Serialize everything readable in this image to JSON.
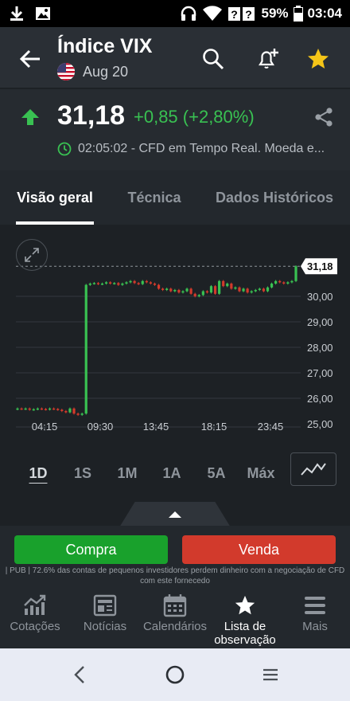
{
  "status_bar": {
    "battery": "59%",
    "time": "03:04"
  },
  "header": {
    "title": "Índice VIX",
    "date": "Aug 20"
  },
  "quote": {
    "price": "31,18",
    "change": "+0,85 (+2,80%)",
    "time_info": "02:05:02 - CFD em Tempo Real. Moeda e...",
    "up_color": "#39c152"
  },
  "tabs": [
    {
      "label": "Visão geral",
      "active": true
    },
    {
      "label": "Técnica",
      "active": false
    },
    {
      "label": "Dados Históricos",
      "active": false
    }
  ],
  "chart_data": {
    "type": "candlestick",
    "y_ticks": [
      "31,18",
      "30,00",
      "29,00",
      "28,00",
      "27,00",
      "26,00",
      "25,00"
    ],
    "x_ticks": [
      "04:15",
      "09:30",
      "13:45",
      "18:15",
      "23:45"
    ],
    "last_value": "31,18",
    "ylim": [
      25.0,
      31.5
    ],
    "closes": [
      25.6,
      25.58,
      25.6,
      25.55,
      25.57,
      25.6,
      25.58,
      25.56,
      25.6,
      25.58,
      25.55,
      25.5,
      25.45,
      25.6,
      25.4,
      25.35,
      25.4,
      30.45,
      30.5,
      30.52,
      30.48,
      30.5,
      30.55,
      30.5,
      30.52,
      30.45,
      30.5,
      30.55,
      30.6,
      30.52,
      30.48,
      30.6,
      30.55,
      30.5,
      30.45,
      30.3,
      30.25,
      30.3,
      30.2,
      30.25,
      30.15,
      30.2,
      30.3,
      30.1,
      30.0,
      30.05,
      30.2,
      30.15,
      30.4,
      30.1,
      30.6,
      30.4,
      30.5,
      30.3,
      30.35,
      30.2,
      30.3,
      30.15,
      30.2,
      30.25,
      30.3,
      30.2,
      30.35,
      30.5,
      30.6,
      30.55,
      30.5,
      30.55,
      30.6,
      31.18
    ]
  },
  "ranges": [
    {
      "label": "1D",
      "active": true
    },
    {
      "label": "1S",
      "active": false
    },
    {
      "label": "1M",
      "active": false
    },
    {
      "label": "1A",
      "active": false
    },
    {
      "label": "5A",
      "active": false
    },
    {
      "label": "Máx",
      "active": false
    }
  ],
  "trade": {
    "buy_label": "Compra",
    "sell_label": "Venda",
    "disclaimer": "| PUB | 72.6% das contas de pequenos investidores perdem dinheiro com a negociação de CFD com este fornecedo"
  },
  "bottom_nav": [
    {
      "label": "Cotações",
      "icon": "chart-growth-icon",
      "active": false
    },
    {
      "label": "Notícias",
      "icon": "newspaper-icon",
      "active": false
    },
    {
      "label": "Calendários",
      "icon": "calendar-icon",
      "active": false
    },
    {
      "label": "Lista de observação",
      "icon": "star-icon",
      "active": true
    },
    {
      "label": "Mais",
      "icon": "menu-icon",
      "active": false
    }
  ]
}
